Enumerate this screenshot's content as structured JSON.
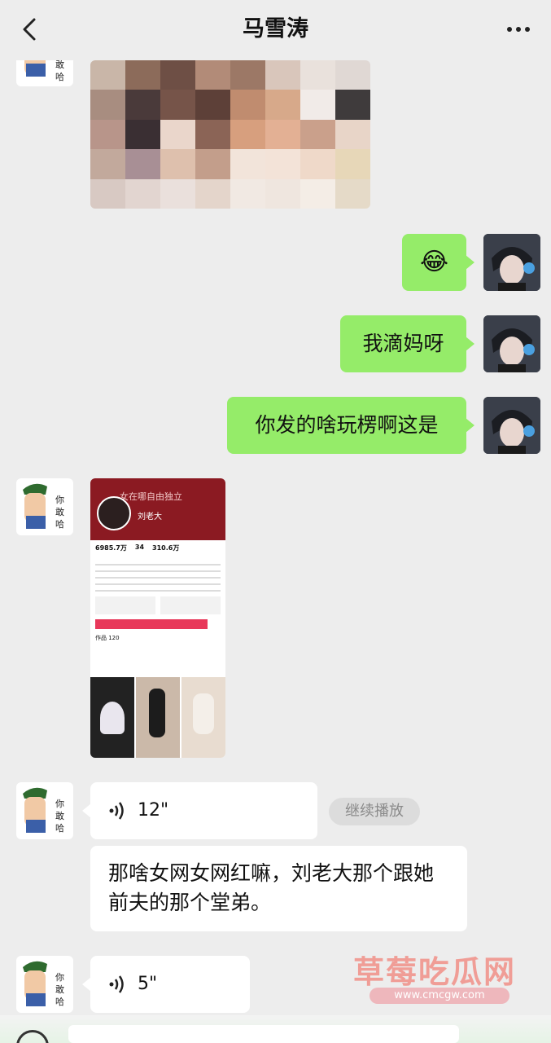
{
  "header": {
    "title": "马雪涛"
  },
  "messages": {
    "sent1": "😂",
    "sent2": "我滴妈呀",
    "sent3": "你发的啥玩楞啊这是",
    "voice1_duration": "12\"",
    "voice1_action": "继续播放",
    "text1": "那啥女网女网红嘛，刘老大那个跟她前夫的那个堂弟。",
    "voice2_duration": "5\""
  },
  "shared_profile": {
    "banner_text": "女在哪自由独立",
    "name": "刘老大",
    "stats": [
      "6985.7万",
      "34",
      "310.6万"
    ],
    "tab_label": "作品 120"
  },
  "sticker_text": "你\n敢\n哈?",
  "watermark": {
    "title": "草莓吃瓜网",
    "url": "www.cmcgw.com"
  },
  "colors": {
    "sent_bubble": "#95ec69",
    "received_bubble": "#ffffff",
    "background": "#ededed",
    "profile_red": "#8b1a22"
  }
}
